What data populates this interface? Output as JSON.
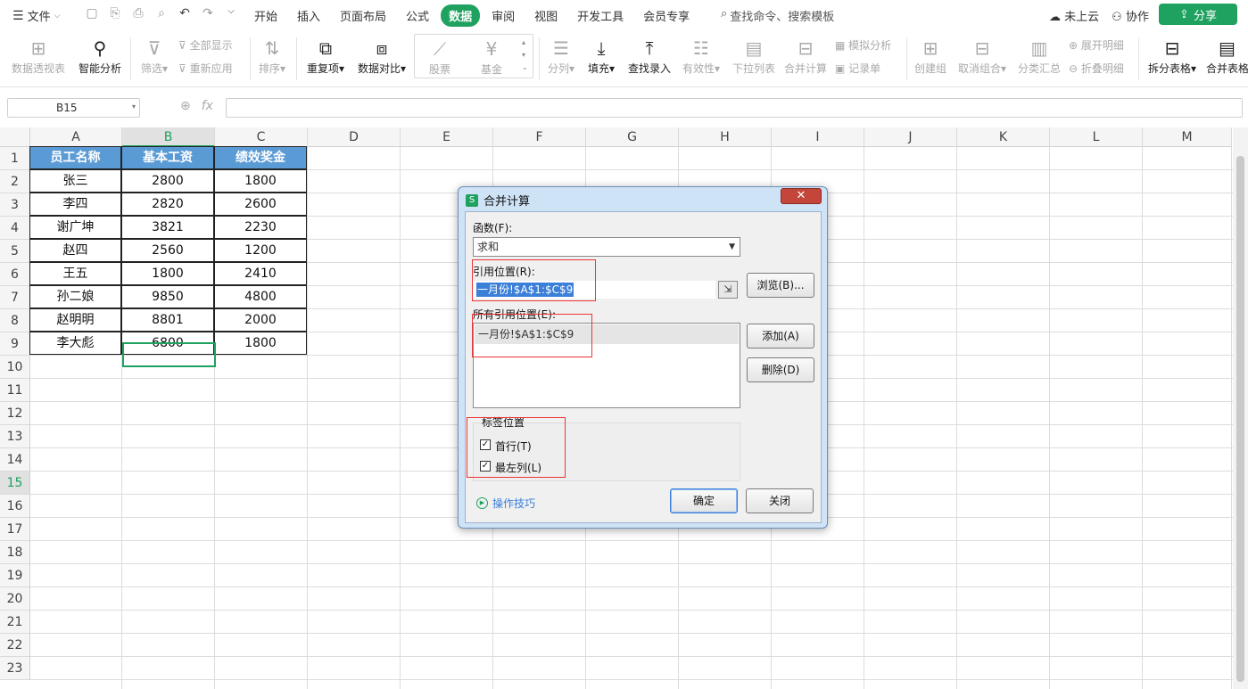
{
  "menubar": {
    "file": "文件",
    "tabs": [
      {
        "label": "开始",
        "active": false
      },
      {
        "label": "插入",
        "active": false
      },
      {
        "label": "页面布局",
        "active": false
      },
      {
        "label": "公式",
        "active": false
      },
      {
        "label": "数据",
        "active": true
      },
      {
        "label": "审阅",
        "active": false
      },
      {
        "label": "视图",
        "active": false
      },
      {
        "label": "开发工具",
        "active": false
      },
      {
        "label": "会员专享",
        "active": false
      }
    ],
    "search_placeholder": "查找命令、搜索模板",
    "cloud_status": "未上云",
    "collab": "协作",
    "share": "分享",
    "accent_color": "#1fa160"
  },
  "ribbon": {
    "pivot": "数据透视表",
    "smart_analysis": "智能分析",
    "filter": "筛选",
    "show_all": "全部显示",
    "reapply": "重新应用",
    "sort": "排序",
    "duplicates": "重复项",
    "compare": "数据对比",
    "stock": "股票",
    "fund": "基金",
    "split": "分列",
    "fill": "填充",
    "lookup": "查找录入",
    "validity": "有效性",
    "dropdown": "下拉列表",
    "consolidate": "合并计算",
    "simulate": "模拟分析",
    "record": "记录单",
    "create_group": "创建组",
    "ungroup": "取消组合",
    "subtotal": "分类汇总",
    "expand": "展开明细",
    "collapse": "折叠明细",
    "split_table": "拆分表格",
    "merge_table": "合并表格"
  },
  "formulabar": {
    "name_box": "B15",
    "fx": "fx",
    "formula": ""
  },
  "sheet": {
    "columns": [
      "A",
      "B",
      "C",
      "D",
      "E",
      "F",
      "G",
      "H",
      "I",
      "J",
      "K",
      "L",
      "M"
    ],
    "selected_column": "B",
    "selected_row": 15,
    "rows": [
      "1",
      "2",
      "3",
      "4",
      "5",
      "6",
      "7",
      "8",
      "9",
      "10",
      "11",
      "12",
      "13",
      "14",
      "15",
      "16",
      "17",
      "18",
      "19",
      "20",
      "21",
      "22",
      "23"
    ],
    "header": [
      "员工名称",
      "基本工资",
      "绩效奖金"
    ],
    "header_color": "#5b9bd5",
    "data": [
      [
        "张三",
        "2800",
        "1800"
      ],
      [
        "李四",
        "2820",
        "2600"
      ],
      [
        "谢广坤",
        "3821",
        "2230"
      ],
      [
        "赵四",
        "2560",
        "1200"
      ],
      [
        "王五",
        "1800",
        "2410"
      ],
      [
        "孙二娘",
        "9850",
        "4800"
      ],
      [
        "赵明明",
        "8801",
        "2000"
      ],
      [
        "李大彪",
        "6800",
        "1800"
      ]
    ]
  },
  "dialog": {
    "title": "合并计算",
    "function_label": "函数(F):",
    "function_value": "求和",
    "ref_label": "引用位置(R):",
    "ref_value": "一月份!$A$1:$C$9",
    "browse": "浏览(B)...",
    "all_refs_label": "所有引用位置(E):",
    "all_refs": [
      "一月份!$A$1:$C$9"
    ],
    "add": "添加(A)",
    "delete": "删除(D)",
    "label_pos": "标签位置",
    "first_row": "首行(T)",
    "left_col": "最左列(L)",
    "first_row_checked": true,
    "left_col_checked": true,
    "tips": "操作技巧",
    "ok": "确定",
    "close": "关闭",
    "highlight_color": "#ee3333"
  }
}
